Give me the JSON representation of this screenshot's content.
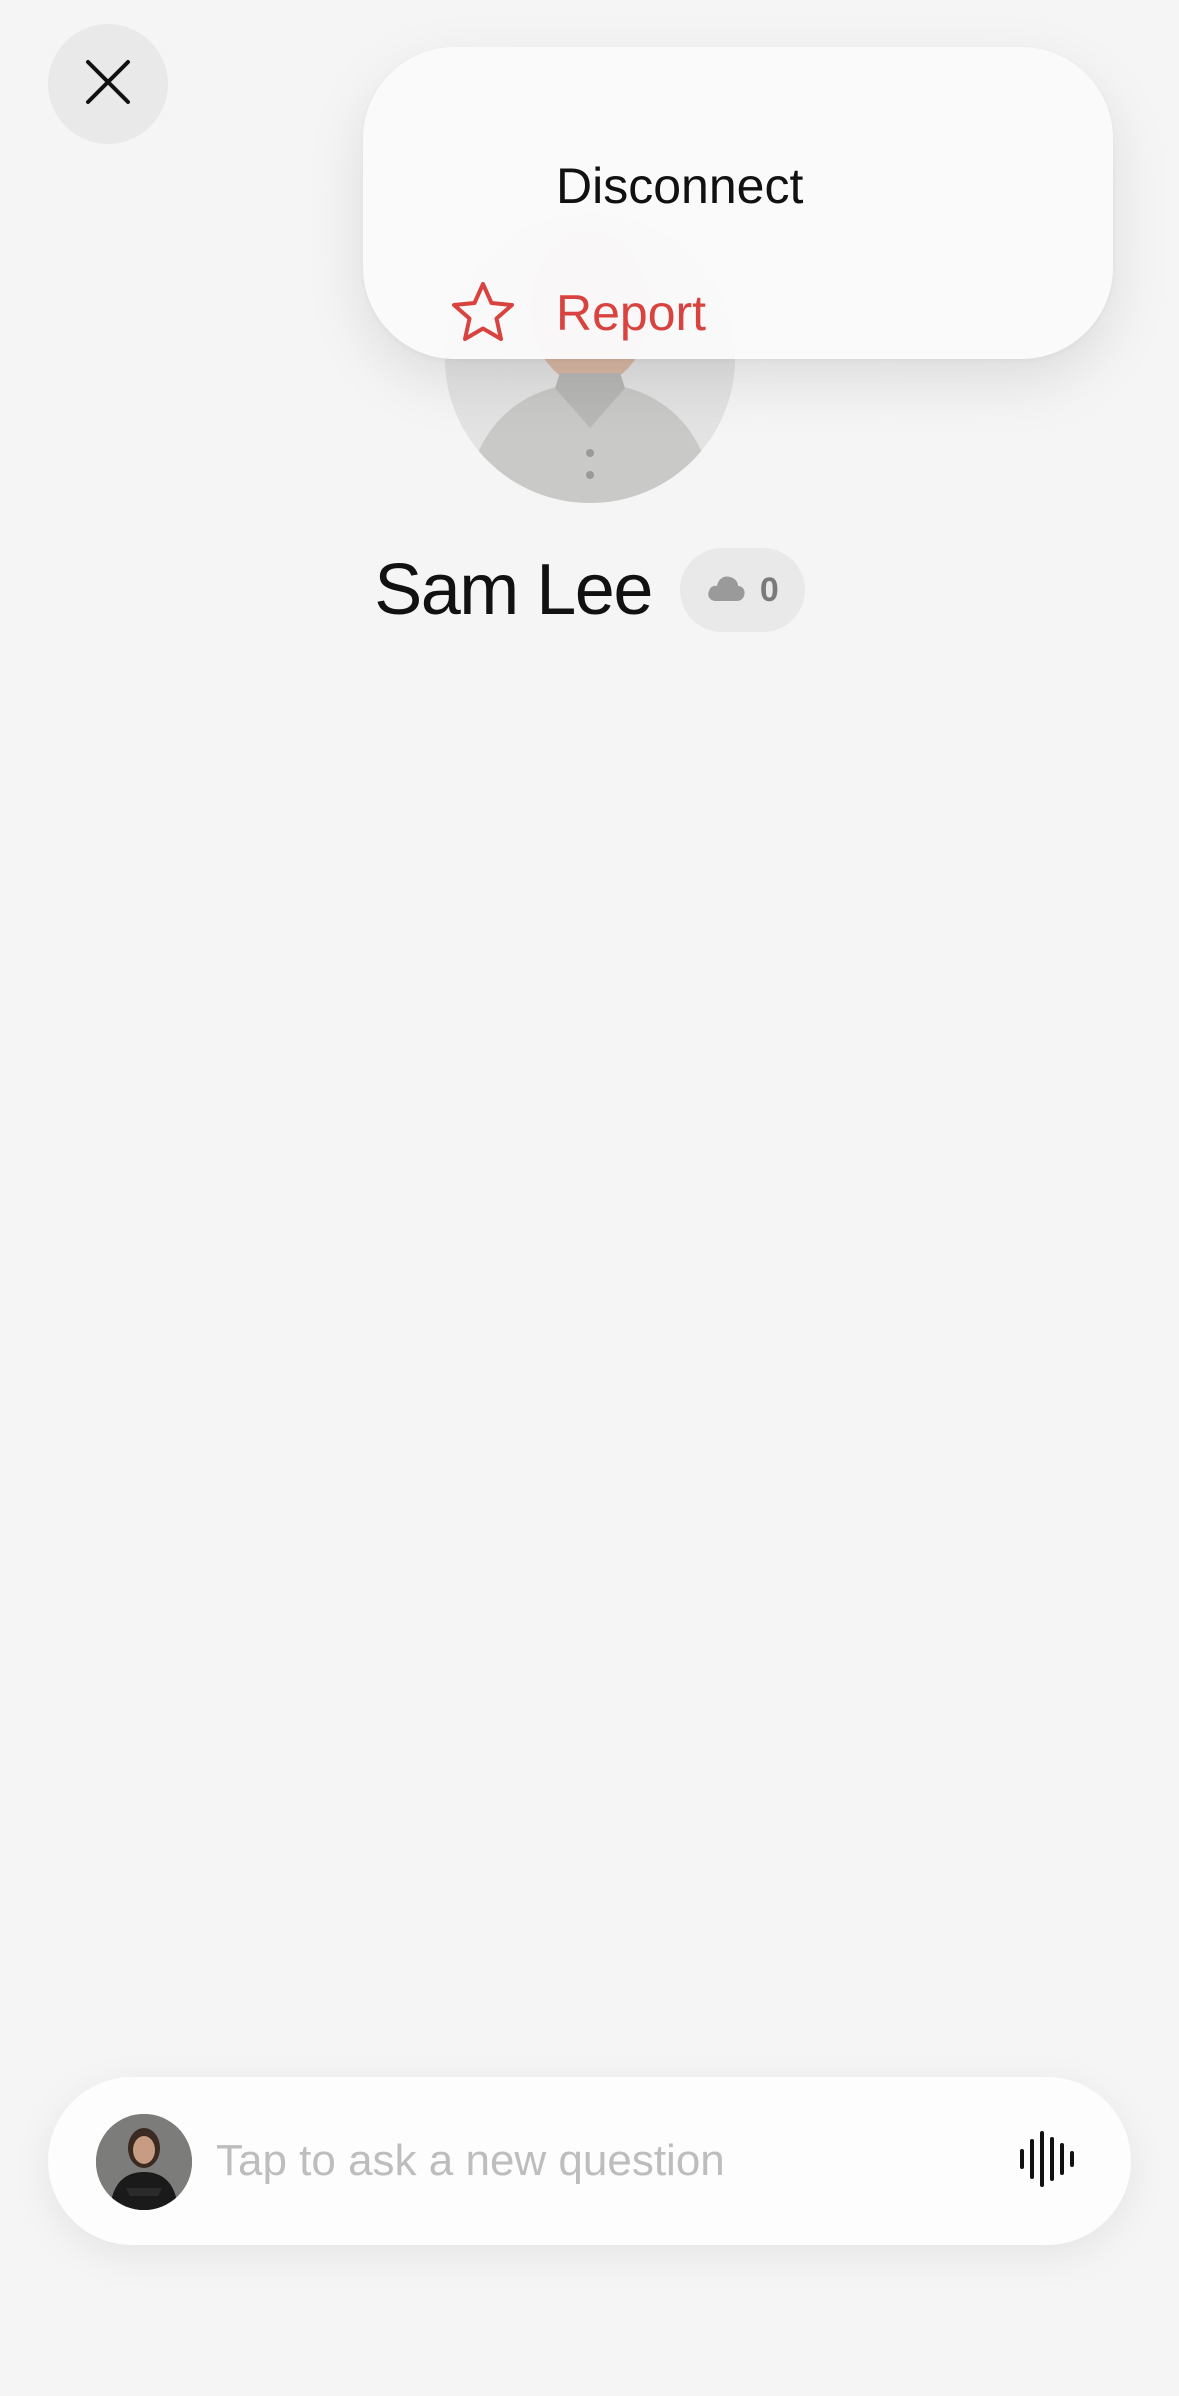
{
  "header": {
    "close_icon": "close-icon"
  },
  "profile": {
    "name": "Sam Lee",
    "count": "0",
    "count_icon": "cloud-icon"
  },
  "menu": {
    "items": [
      {
        "label": "Disconnect",
        "icon": ""
      },
      {
        "label": "Report",
        "icon": "star-icon",
        "color": "#d9433f"
      }
    ]
  },
  "composer": {
    "placeholder": "Tap to ask a new question",
    "value": "",
    "voice_icon": "waveform-icon"
  }
}
